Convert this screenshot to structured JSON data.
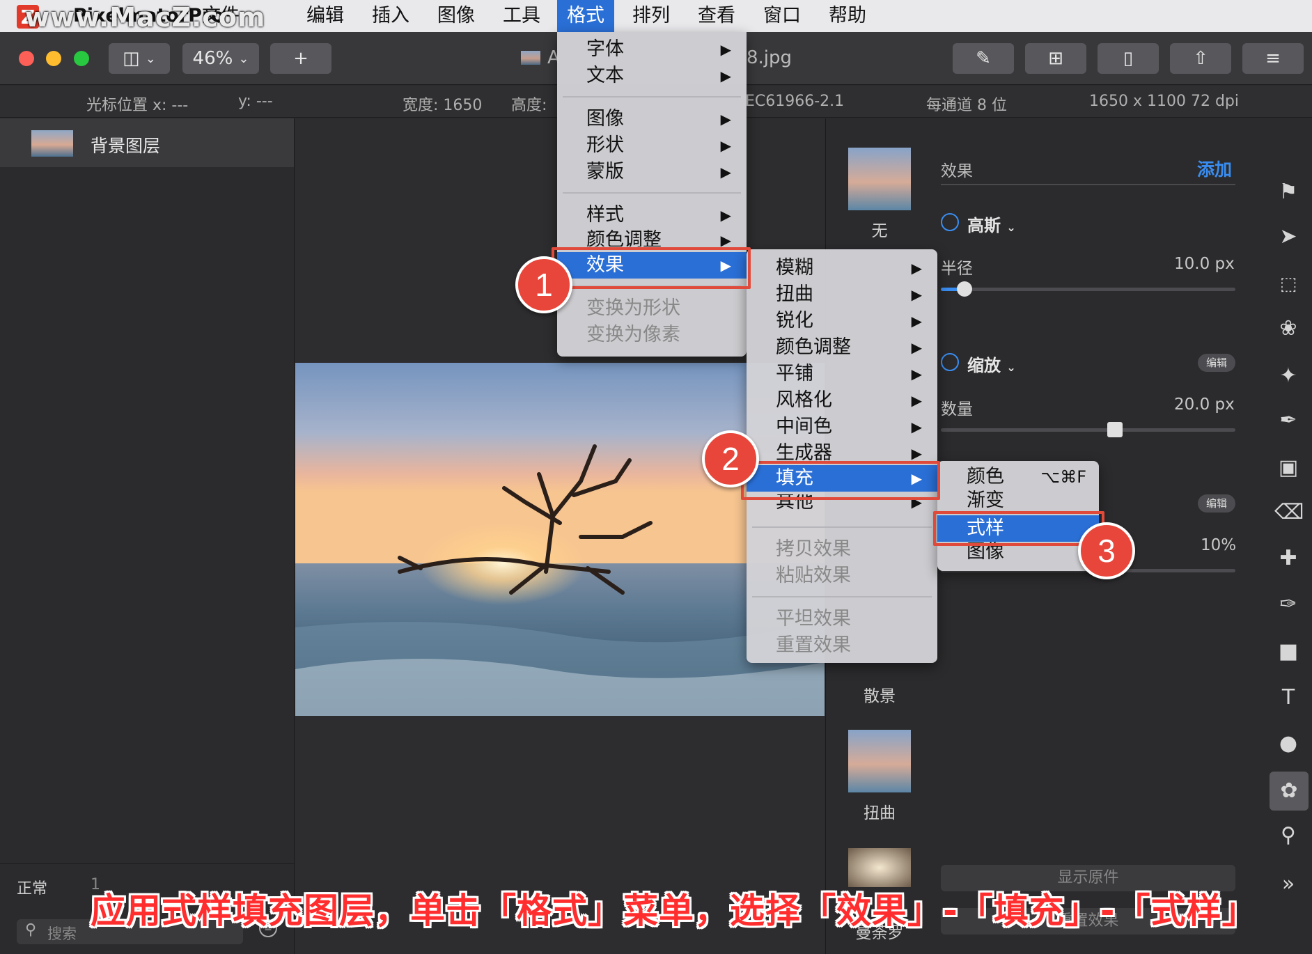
{
  "menubar": {
    "app_name": "PixelmatorPro",
    "watermark": "www.MacZ.com",
    "items": [
      "文件",
      "编辑",
      "插入",
      "图像",
      "工具",
      "格式",
      "排列",
      "查看",
      "窗口",
      "帮助"
    ]
  },
  "toolbar": {
    "zoom": "46%",
    "add_label": "+",
    "doc_prefix": "A",
    "doc_suffix": "8.jpg"
  },
  "infobar": {
    "cursor_x": "光标位置 x:  ---",
    "cursor_y": "y:  ---",
    "width": "宽度:  1650",
    "height": "高度:",
    "color_profile": "EC61966-2.1",
    "bit_depth": "每通道 8 位",
    "dimensions": "1650 x 1100 72 dpi"
  },
  "layers": {
    "background_layer": "背景图层",
    "blend_mode": "正常",
    "opacity_partial": "1",
    "search_placeholder": "搜索"
  },
  "effects_panel": {
    "title": "效果",
    "add_label": "添加",
    "presets": [
      "无",
      "散景",
      "扭曲",
      "曼荼罗"
    ],
    "gaussian": {
      "name": "高斯",
      "param": "半径",
      "value": "10.0 px",
      "level": 0.08
    },
    "zoom": {
      "name": "缩放",
      "param": "数量",
      "value": "20.0 px",
      "level": 0.59,
      "edit": "编辑"
    },
    "third": {
      "value": "10%",
      "edit": "编辑"
    },
    "show_original": "显示原件",
    "reset_effects": "重置效果"
  },
  "format_menu": {
    "items": [
      {
        "label": "字体",
        "sub": true
      },
      {
        "label": "文本",
        "sub": true
      },
      {
        "label": "图像",
        "sub": true
      },
      {
        "label": "形状",
        "sub": true
      },
      {
        "label": "蒙版",
        "sub": true
      },
      {
        "label": "样式",
        "sub": true
      },
      {
        "label": "颜色调整",
        "sub": true
      },
      {
        "label": "效果",
        "sub": true
      },
      {
        "label": "变换为形状",
        "sub": false
      },
      {
        "label": "变换为像素",
        "sub": false
      }
    ]
  },
  "effects_menu": {
    "items": [
      "模糊",
      "扭曲",
      "锐化",
      "颜色调整",
      "平铺",
      "风格化",
      "中间色",
      "生成器",
      "填充",
      "其他"
    ],
    "copy": "拷贝效果",
    "paste": "粘贴效果",
    "flatten": "平坦效果",
    "reset": "重置效果"
  },
  "fill_menu": {
    "items": [
      "颜色",
      "渐变",
      "式样",
      "图像"
    ],
    "color_shortcut": "⌥⌘F"
  },
  "annotations": {
    "steps": [
      "1",
      "2",
      "3"
    ],
    "caption": "应用式样填充图层，单击「格式」菜单，选择「效果」-「填充」-「式样」"
  },
  "colors": {
    "accent": "#2a6fd6",
    "annotation_red": "#e04a3b",
    "panel_bg": "#2b2b2d"
  }
}
